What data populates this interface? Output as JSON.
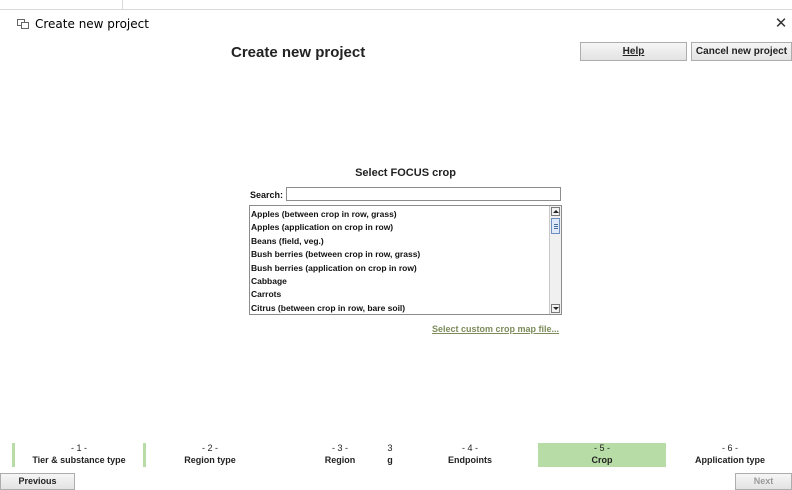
{
  "window": {
    "title": "Create new project",
    "close_glyph": "✕"
  },
  "header": {
    "title": "Create new project",
    "help_label": "Help",
    "cancel_label": "Cancel new project"
  },
  "crop_selector": {
    "title": "Select FOCUS crop",
    "search_label": "Search:",
    "search_value": "",
    "items": [
      "Apples (between crop in row, grass)",
      "Apples (application on crop in row)",
      "Beans (field, veg.)",
      "Bush berries (between crop in row, grass)",
      "Bush berries (application on crop in row)",
      "Cabbage",
      "Carrots",
      "Citrus (between crop in row, bare soil)"
    ],
    "custom_link": "Select custom crop map file..."
  },
  "steps": [
    {
      "num": "- 1 -",
      "label": "Tier & substance type"
    },
    {
      "num": "- 2 -",
      "label": "Region type"
    },
    {
      "num": "- 3 -",
      "label": "Region"
    },
    {
      "num": "3",
      "label": "g"
    },
    {
      "num": "- 4 -",
      "label": "Endpoints"
    },
    {
      "num": "- 5 -",
      "label": "Crop"
    },
    {
      "num": "- 6 -",
      "label": "Application type"
    }
  ],
  "active_step": 5,
  "navigation": {
    "previous_label": "Previous",
    "next_label": "Next"
  },
  "colors": {
    "active_step": "#b7dca5",
    "link": "#7c8c5b",
    "disabled_text": "#9a9a9a"
  },
  "icons": {
    "app": "app-window-icon",
    "close": "close-icon"
  }
}
